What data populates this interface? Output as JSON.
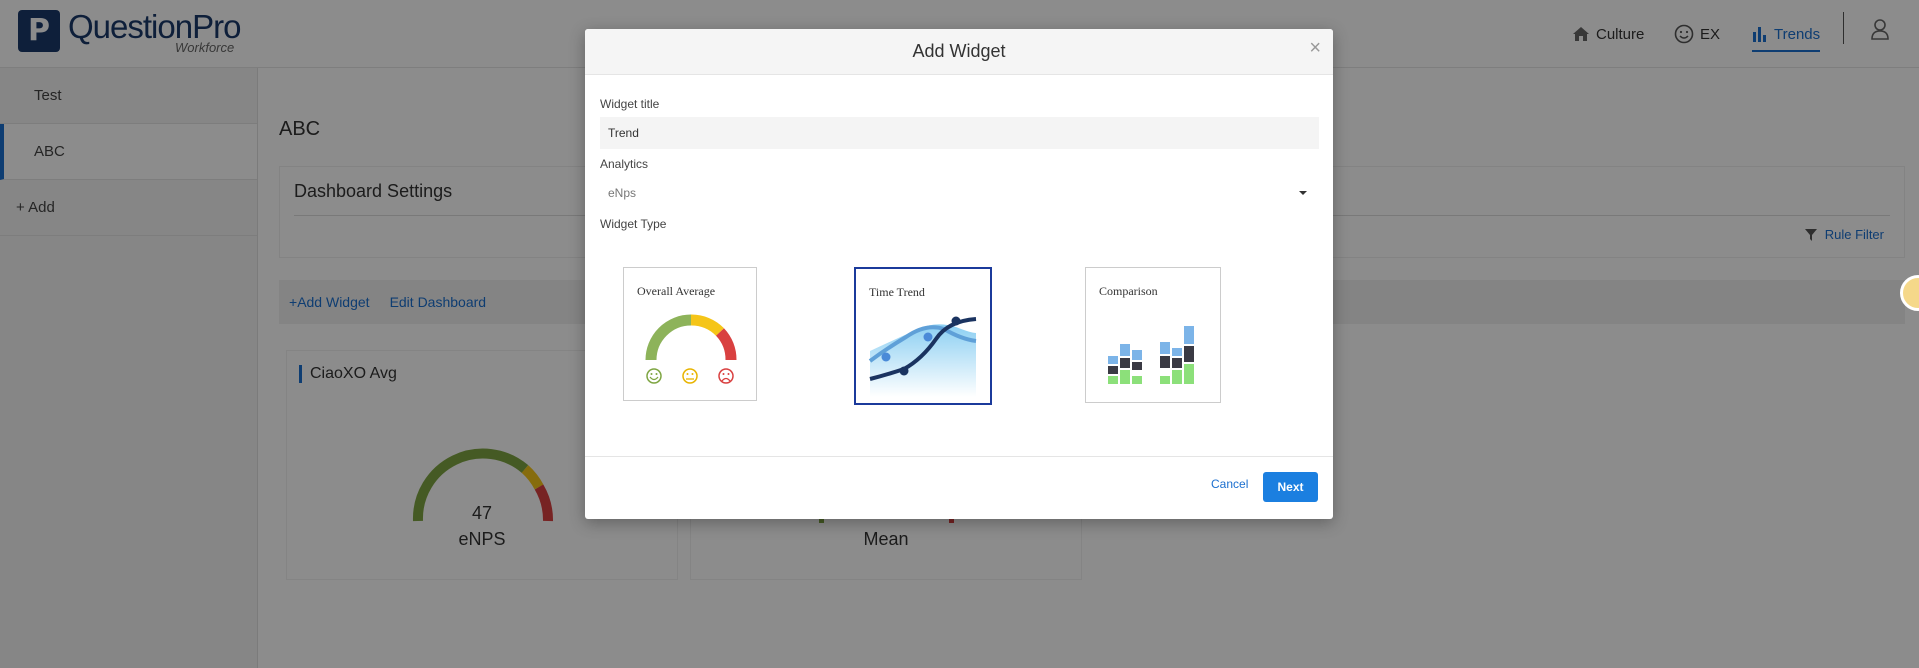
{
  "header": {
    "logo_mark": "P",
    "logo_brand": "QuestionPro",
    "logo_sub": "Workforce",
    "nav": [
      {
        "label": "Culture",
        "icon": "home-icon"
      },
      {
        "label": "EX",
        "icon": "smile-icon"
      },
      {
        "label": "Trends",
        "icon": "bar-chart-icon"
      }
    ],
    "user_icon": "user-icon"
  },
  "sidebar": {
    "items": [
      {
        "label": "Test"
      },
      {
        "label": "ABC"
      },
      {
        "label": "+ Add"
      }
    ]
  },
  "main": {
    "page_title": "ABC",
    "settings_title": "Dashboard Settings",
    "rule_filter": "Rule Filter",
    "add_widget": "Add Widget",
    "edit_dashboard": "Edit Dashboard",
    "cards": [
      {
        "title": "CiaoXO Avg",
        "value": "47",
        "label": "eNPS"
      },
      {
        "title": "",
        "value": "",
        "label": "Mean"
      }
    ]
  },
  "modal": {
    "title": "Add Widget",
    "close": "×",
    "widget_title_label": "Widget title",
    "widget_title_value": "Trend",
    "analytics_label": "Analytics",
    "analytics_value": "eNps",
    "widget_type_label": "Widget Type",
    "types": [
      {
        "label": "Overall Average",
        "selected": false
      },
      {
        "label": "Time Trend",
        "selected": true
      },
      {
        "label": "Comparison",
        "selected": false
      }
    ],
    "cancel": "Cancel",
    "next": "Next"
  },
  "colors": {
    "brand": "#1b3a6b",
    "accent": "#1b6fcf",
    "primary_button": "#1b7fe0",
    "gauge_green": "#7ea542",
    "gauge_yellow": "#f5c518",
    "gauge_red": "#d94040"
  }
}
